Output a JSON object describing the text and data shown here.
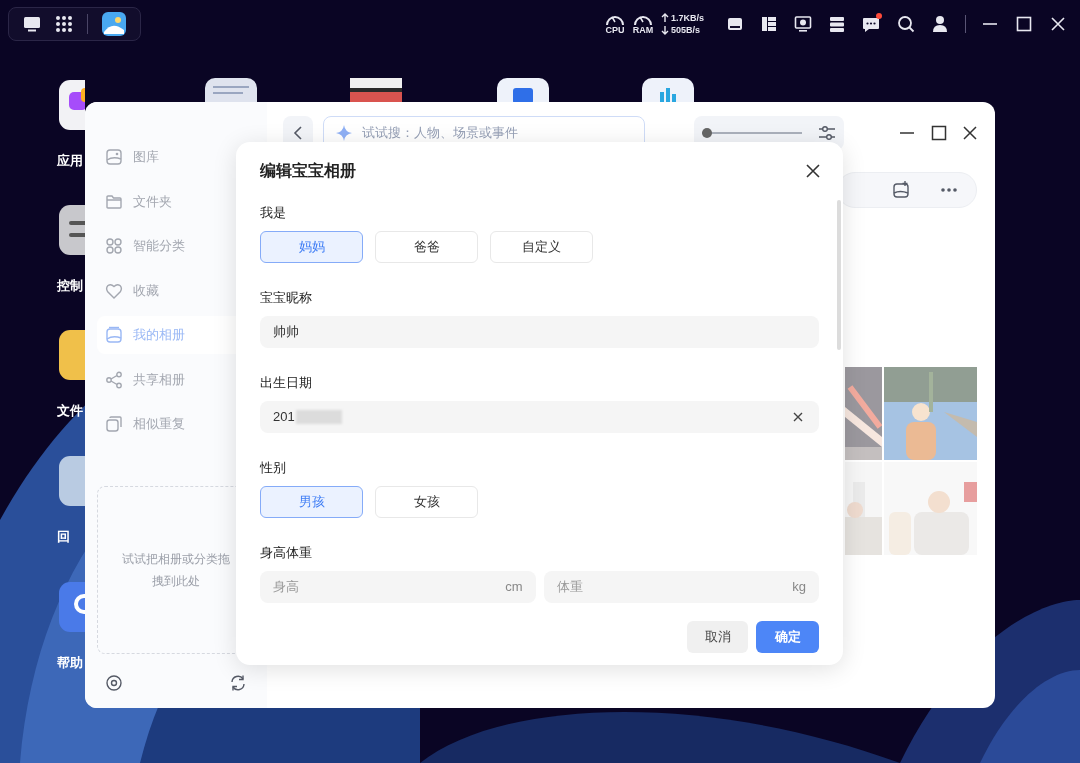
{
  "taskbar": {
    "cpu_label": "CPU",
    "ram_label": "RAM",
    "upload": "1.7KB/s",
    "download": "505B/s",
    "unread_messages": true
  },
  "desktop_icons": [
    {
      "label": "应用"
    },
    {
      "label": "控制"
    },
    {
      "label": "文件"
    },
    {
      "label": "回"
    },
    {
      "label": "帮助"
    }
  ],
  "photos_window": {
    "search": {
      "placeholder": "试试搜：人物、场景或事件"
    },
    "zoom_slider": {
      "level": 0.0
    },
    "sidebar": {
      "items": [
        {
          "label": "图库",
          "selected": false
        },
        {
          "label": "文件夹",
          "selected": false
        },
        {
          "label": "智能分类",
          "selected": false
        },
        {
          "label": "收藏",
          "selected": false
        },
        {
          "label": "我的相册",
          "selected": true
        },
        {
          "label": "共享相册",
          "selected": false
        },
        {
          "label": "相似重复",
          "selected": false
        }
      ],
      "drop_hint": "试试把相册或分类拖拽到此处"
    }
  },
  "dialog": {
    "title": "编辑宝宝相册",
    "role": {
      "label": "我是",
      "options": [
        {
          "label": "妈妈",
          "selected": true
        },
        {
          "label": "爸爸",
          "selected": false
        },
        {
          "label": "自定义",
          "selected": false
        }
      ]
    },
    "nickname": {
      "label": "宝宝昵称",
      "value": "帅帅"
    },
    "birth_date": {
      "label": "出生日期",
      "value": "201"
    },
    "gender": {
      "label": "性别",
      "options": [
        {
          "label": "男孩",
          "selected": true
        },
        {
          "label": "女孩",
          "selected": false
        }
      ]
    },
    "body": {
      "label": "身高体重",
      "height": {
        "placeholder": "身高",
        "unit": "cm"
      },
      "weight": {
        "placeholder": "体重",
        "unit": "kg"
      }
    },
    "buttons": {
      "cancel": "取消",
      "confirm": "确定"
    }
  }
}
